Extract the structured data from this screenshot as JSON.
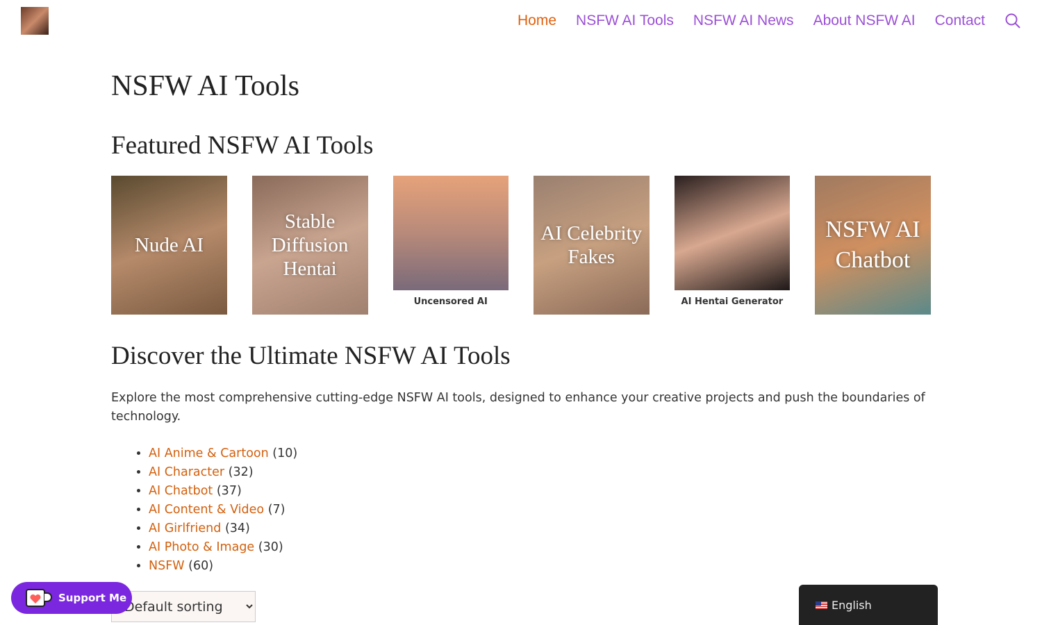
{
  "nav": {
    "items": [
      {
        "label": "Home",
        "active": true
      },
      {
        "label": "NSFW AI Tools"
      },
      {
        "label": "NSFW AI News"
      },
      {
        "label": "About NSFW AI"
      },
      {
        "label": "Contact"
      }
    ],
    "search_icon": "search-icon"
  },
  "page_title": "NSFW AI Tools",
  "featured": {
    "heading": "Featured NSFW AI Tools",
    "tiles": [
      {
        "overlay": "Nude AI"
      },
      {
        "overlay": "Stable Diffusion Hentai"
      },
      {
        "caption": "Uncensored AI"
      },
      {
        "overlay": "AI Celebrity Fakes"
      },
      {
        "caption": "AI Hentai Generator"
      },
      {
        "overlay": "NSFW AI Chatbot"
      }
    ]
  },
  "discover": {
    "heading": "Discover the Ultimate NSFW AI Tools",
    "text": "Explore the most comprehensive cutting-edge NSFW AI tools, designed to enhance your creative projects and push the boundaries of technology."
  },
  "categories": [
    {
      "label": "AI Anime & Cartoon",
      "count": "(10)"
    },
    {
      "label": "AI Character",
      "count": "(32)"
    },
    {
      "label": "AI Chatbot",
      "count": "(37)"
    },
    {
      "label": "AI Content & Video",
      "count": "(7)"
    },
    {
      "label": "AI Girlfriend",
      "count": "(34)"
    },
    {
      "label": "AI Photo & Image",
      "count": "(30)"
    },
    {
      "label": "NSFW",
      "count": "(60)"
    }
  ],
  "sorting": {
    "selected": "Default sorting"
  },
  "support": {
    "label": "Support Me"
  },
  "language": {
    "label": "English"
  },
  "colors": {
    "nav": "#9b4fd6",
    "active": "#e0600d",
    "link": "#d2600d",
    "support": "#7b27e0"
  }
}
